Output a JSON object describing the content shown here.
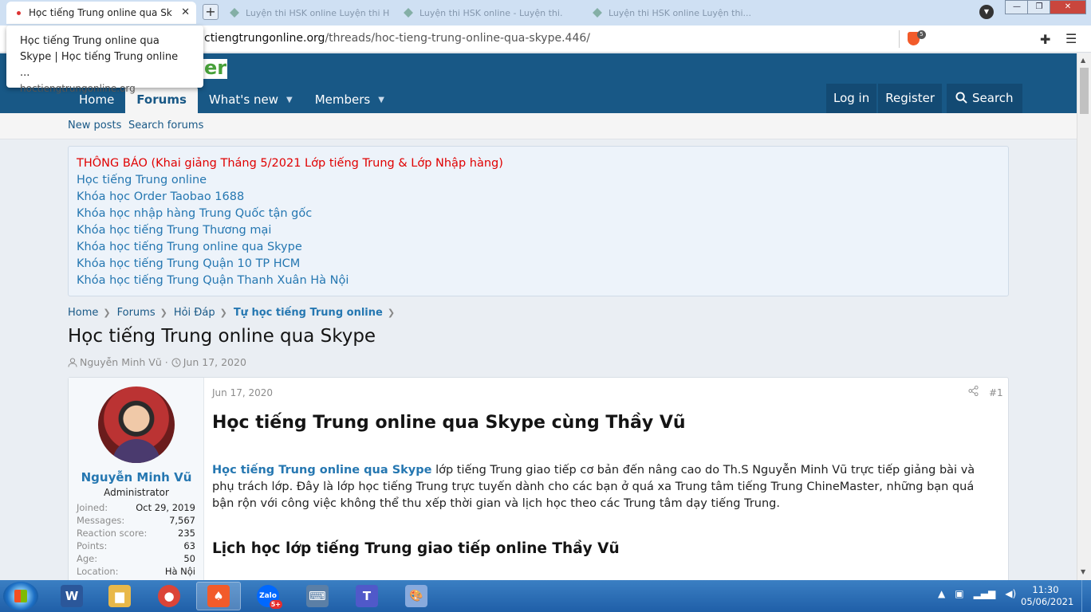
{
  "browser": {
    "active_tab_title": "Học tiếng Trung online qua Skype",
    "bg_tabs": [
      "Luyện thi HSK online Luyện thi HSK online",
      "Luyện thi HSK online - Luyện thi...",
      "Luyện thi HSK online Luyện thi..."
    ],
    "new_tab": "+",
    "tooltip_title": "Học tiếng Trung online qua Skype | Học tiếng Trung online ...",
    "tooltip_domain": "hoctiengtrungonline.org",
    "url_prefix": "ctiengtrungonline.org",
    "url_path": "/threads/hoc-tieng-trung-online-qua-skype.446/",
    "shield_count": "5",
    "close": "✕",
    "minimize": "—",
    "maximize": "❐"
  },
  "site": {
    "logo_suffix": "er",
    "nav": [
      {
        "label": "Home"
      },
      {
        "label": "Forums"
      },
      {
        "label": "What's new"
      },
      {
        "label": "Members"
      }
    ],
    "nav_right": {
      "login": "Log in",
      "register": "Register",
      "search": "Search"
    },
    "subnav": {
      "new_posts": "New posts",
      "search_forums": "Search forums"
    },
    "notice": [
      "THÔNG BÁO (Khai giảng Tháng 5/2021 Lớp tiếng Trung & Lớp Nhập hàng)",
      "Học tiếng Trung online",
      "Khóa học Order Taobao 1688",
      "Khóa học nhập hàng Trung Quốc tận gốc",
      "Khóa học tiếng Trung Thương mại",
      "Khóa học tiếng Trung online qua Skype",
      "Khóa học tiếng Trung Quận 10 TP HCM",
      "Khóa học tiếng Trung Quận Thanh Xuân Hà Nội"
    ],
    "breadcrumb": [
      "Home",
      "Forums",
      "Hỏi Đáp",
      "Tự học tiếng Trung online"
    ],
    "thread_title": "Học tiếng Trung online qua Skype",
    "thread_author": "Nguyễn Minh Vũ",
    "thread_date": "Jun 17, 2020"
  },
  "post": {
    "date": "Jun 17, 2020",
    "number": "#1",
    "user": {
      "name": "Nguyễn Minh Vũ",
      "title": "Administrator",
      "stats": [
        {
          "k": "Joined:",
          "v": "Oct 29, 2019"
        },
        {
          "k": "Messages:",
          "v": "7,567"
        },
        {
          "k": "Reaction score:",
          "v": "235"
        },
        {
          "k": "Points:",
          "v": "63"
        },
        {
          "k": "Age:",
          "v": "50"
        },
        {
          "k": "Location:",
          "v": "Hà Nội"
        }
      ]
    },
    "heading": "Học tiếng Trung online qua Skype cùng Thầy Vũ",
    "para_link": "Học tiếng Trung online qua Skype",
    "para_text": " lớp tiếng Trung giao tiếp cơ bản đến nâng cao do Th.S Nguyễn Minh Vũ trực tiếp giảng bài và phụ trách lớp. Đây là lớp học tiếng Trung trực tuyến dành cho các bạn ở quá xa Trung tâm tiếng Trung ChineMaster, những bạn quá bận rộn với công việc không thể thu xếp thời gian và lịch học theo các Trung tâm dạy tiếng Trung.",
    "subheading": "Lịch học lớp tiếng Trung giao tiếp online Thầy Vũ"
  },
  "taskbar": {
    "apps": [
      {
        "name": "word",
        "glyph": "W",
        "color": "#2b579a"
      },
      {
        "name": "explorer",
        "glyph": "▆",
        "color": "#e8b84a"
      },
      {
        "name": "chrome",
        "glyph": "●",
        "color": "#db4437"
      },
      {
        "name": "brave",
        "glyph": "♠",
        "color": "#f25b2a"
      },
      {
        "name": "zalo",
        "glyph": "Zalo",
        "color": "#0068ff",
        "badge": "5+"
      },
      {
        "name": "keyboard",
        "glyph": "⌨",
        "color": "#5b7fa6"
      },
      {
        "name": "teams",
        "glyph": "T",
        "color": "#5059c9"
      },
      {
        "name": "paint",
        "glyph": "🎨",
        "color": "#88aadd"
      }
    ],
    "time": "11:30",
    "date": "05/06/2021"
  },
  "colors": {
    "header": "#185886",
    "link": "#2577b1",
    "notice_red": "#e00000"
  }
}
